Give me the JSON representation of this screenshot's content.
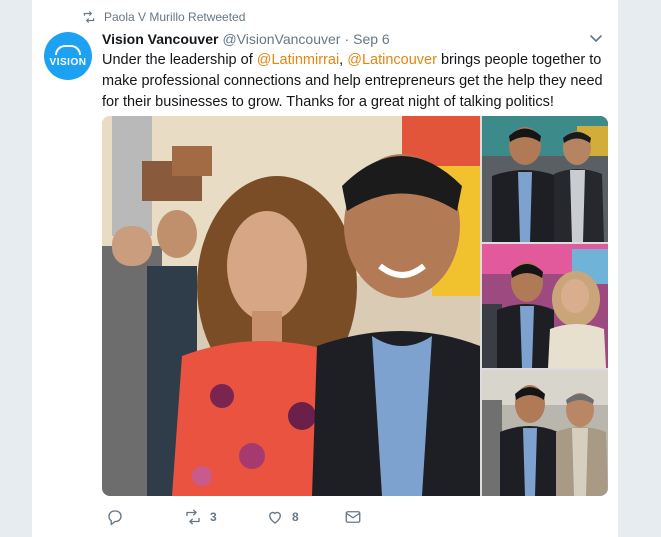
{
  "retweet": {
    "text": "Paola V Murillo Retweeted"
  },
  "author": {
    "avatar_text": "VISION",
    "name": "Vision Vancouver",
    "handle": "@VisionVancouver",
    "separator": "·",
    "date": "Sep 6"
  },
  "tweet": {
    "t1": "Under the leadership of ",
    "mention1": "@Latinmirrai",
    "t2": ", ",
    "mention2": "@Latincouver",
    "t3": " brings people together to make professional connections and help entrepreneurs get the help they need for their businesses to grow.  Thanks for a great night of talking politics!"
  },
  "actions": {
    "reply_count": "",
    "retweet_count": "3",
    "like_count": "8"
  },
  "colors": {
    "accent": "#1da1f2",
    "mention": "#e8850f",
    "muted": "#657786"
  }
}
